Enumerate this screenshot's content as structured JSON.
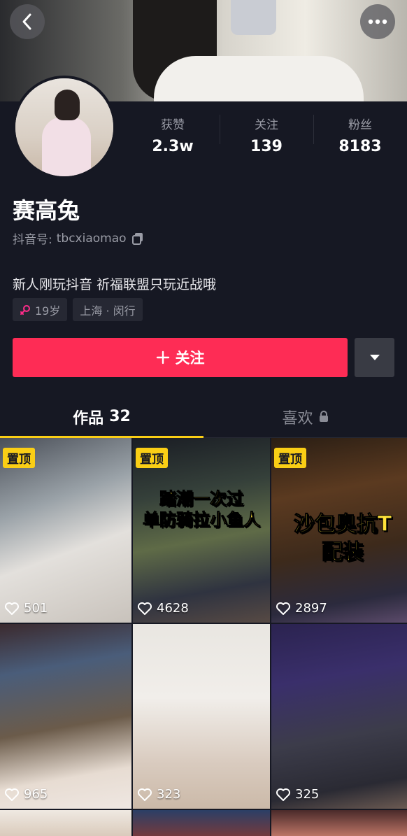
{
  "profile": {
    "name": "赛高兔",
    "id_label": "抖音号:",
    "id_value": "tbcxiaomao",
    "bio": "新人刚玩抖音 祈福联盟只玩近战哦",
    "age": "19岁",
    "location": "上海 · 闵行"
  },
  "stats": [
    {
      "label": "获赞",
      "value": "2.3w"
    },
    {
      "label": "关注",
      "value": "139"
    },
    {
      "label": "粉丝",
      "value": "8183"
    }
  ],
  "actions": {
    "follow_label": "关注"
  },
  "tabs": {
    "works_label": "作品",
    "works_count": "32",
    "likes_label": "喜欢"
  },
  "videos": [
    {
      "pinned_label": "置顶",
      "likes": "501",
      "overlay": ""
    },
    {
      "pinned_label": "置顶",
      "likes": "4628",
      "overlay": "踏潮一次过\n单防骑拉小鱼人"
    },
    {
      "pinned_label": "置顶",
      "likes": "2897",
      "overlay": "沙包奥抗T\n配装"
    },
    {
      "pinned_label": "",
      "likes": "965",
      "overlay": ""
    },
    {
      "pinned_label": "",
      "likes": "323",
      "overlay": ""
    },
    {
      "pinned_label": "",
      "likes": "325",
      "overlay": ""
    }
  ],
  "colors": {
    "background": "#161823",
    "follow_button": "#fe2c55",
    "pin_badge": "#face15",
    "tab_indicator": "#face15"
  },
  "icons": {
    "back": "back-chevron-icon",
    "more": "more-dots-icon",
    "copy": "copy-icon",
    "gender": "female-icon",
    "dropdown": "triangle-down-icon",
    "lock": "lock-icon",
    "heart": "heart-outline-icon"
  }
}
